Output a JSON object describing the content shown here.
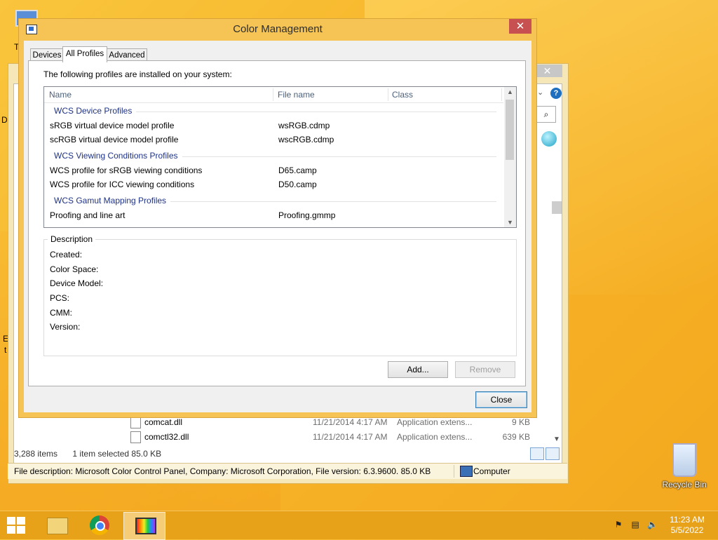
{
  "dialog": {
    "title": "Color Management",
    "close_glyph": "✕",
    "tabs": [
      {
        "label": "Devices"
      },
      {
        "label": "All Profiles",
        "active": true
      },
      {
        "label": "Advanced"
      }
    ],
    "installed_text": "The following profiles are installed on your system:",
    "columns": {
      "name": "Name",
      "file": "File name",
      "class": "Class"
    },
    "groups": [
      {
        "title": "WCS Device Profiles",
        "rows": [
          {
            "name": "sRGB virtual device model profile",
            "file": "wsRGB.cdmp"
          },
          {
            "name": "scRGB virtual device model profile",
            "file": "wscRGB.cdmp"
          }
        ]
      },
      {
        "title": "WCS Viewing Conditions Profiles",
        "rows": [
          {
            "name": "WCS profile for sRGB viewing conditions",
            "file": "D65.camp"
          },
          {
            "name": "WCS profile for ICC viewing conditions",
            "file": "D50.camp"
          }
        ]
      },
      {
        "title": "WCS Gamut Mapping Profiles",
        "rows": [
          {
            "name": "Proofing and line art",
            "file": "Proofing.gmmp"
          }
        ]
      }
    ],
    "description": {
      "legend": "Description",
      "fields": [
        "Created:",
        "Color Space:",
        "Device Model:",
        "PCS:",
        "CMM:",
        "Version:"
      ]
    },
    "buttons": {
      "add": "Add...",
      "remove": "Remove",
      "close": "Close"
    }
  },
  "explorer": {
    "files": [
      {
        "name": "comcat.dll",
        "date": "11/21/2014 4:17 AM",
        "type": "Application extens...",
        "size": "9 KB"
      },
      {
        "name": "comctl32.dll",
        "date": "11/21/2014 4:17 AM",
        "type": "Application extens...",
        "size": "639 KB"
      }
    ],
    "status": {
      "items": "3,288 items",
      "selected": "1 item selected  85.0 KB"
    },
    "file_description": "File description: Microsoft Color Control Panel, Company: Microsoft Corporation, File version: 6.3.9600.  85.0 KB",
    "location": "Computer",
    "close_glyph": "✕",
    "help_glyph": "?"
  },
  "desktop": {
    "recycle_bin": "Recycle Bin",
    "fragments": [
      "T",
      "D",
      "E",
      "t"
    ]
  },
  "taskbar": {
    "time": "11:23 AM",
    "date": "5/5/2022"
  }
}
